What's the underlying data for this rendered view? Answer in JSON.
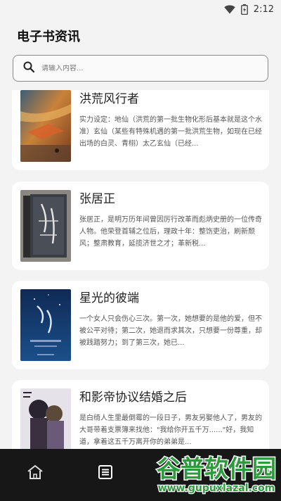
{
  "status_bar": {
    "time": "2:12",
    "icons": [
      "wifi-icon",
      "battery-icon"
    ]
  },
  "header": {
    "title": "电子书资讯"
  },
  "search": {
    "placeholder": "请输入内容...",
    "value": "",
    "icon": "search-icon"
  },
  "books": [
    {
      "title": "洪荒风行者",
      "description": "实力设定：地仙（洪荒的第一批生物化形后基本就是这个水准）玄仙（某些有特殊机遇的第一批洪荒生物，如现在已经出场的白灵、青栩）太乙玄仙（已经..."
    },
    {
      "title": "张居正",
      "description": "张居正，是明万历年间曾因厉行改革而彪炳史册的一位传奇人物。他荣登首辅之位后，理政十年：整饬吏治，刷新颓风；整肃教育，延揽济世之才；革新税..."
    },
    {
      "title": "星光的彼端",
      "description": "一个女人只会伤心三次。第一次，她想要的是他的爱，但不被公平对待；第二次，她退而求其次，只想要一份尊重，却被践踏努力；到了第三次，她已..."
    },
    {
      "title": "和影帝协议结婚之后",
      "description": "是白绮人生里最倒霉的一段日子，男友另娶他人了，男友的大哥带着支票簿来找他：\"我给你开五千万......\"好，我知道，拿着这五千万离开你的弟弟是..."
    }
  ],
  "bottom_nav": {
    "items": [
      {
        "icon": "home-icon",
        "active": false
      },
      {
        "icon": "list-icon",
        "active": true
      }
    ]
  },
  "watermark": {
    "text_main": "谷普软件园",
    "text_url": "www.gupuxlazal.com"
  },
  "colors": {
    "background": "#f3f3f3",
    "card": "#ffffff",
    "nav": "#171717",
    "watermark_green": "#2d9a3e"
  }
}
